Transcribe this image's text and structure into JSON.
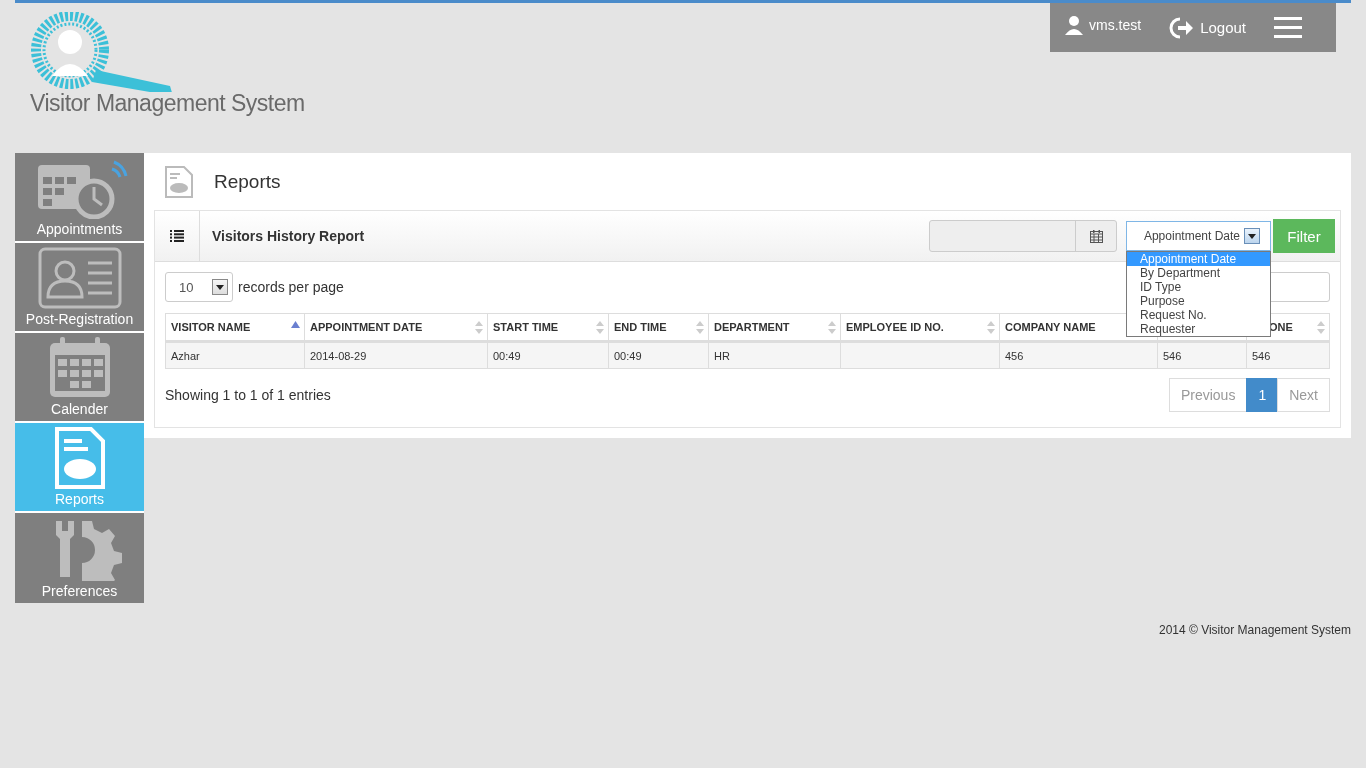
{
  "header": {
    "logo_text": "Visitor Management System",
    "user": "vms.test",
    "logout": "Logout"
  },
  "sidebar": {
    "items": [
      {
        "label": "Appointments",
        "kind": "appointments",
        "selected": false
      },
      {
        "label": "Post-Registration",
        "kind": "registration",
        "selected": false
      },
      {
        "label": "Calender",
        "kind": "calendar",
        "selected": false
      },
      {
        "label": "Reports",
        "kind": "reports",
        "selected": true
      },
      {
        "label": "Preferences",
        "kind": "preferences",
        "selected": false
      }
    ]
  },
  "page": {
    "title": "Reports"
  },
  "report": {
    "title": "Visitors History Report",
    "filter_select": {
      "value": "Appointment Date",
      "expanded": true,
      "options": [
        {
          "label": "Appointment Date",
          "selected": true
        },
        {
          "label": "By Department",
          "selected": false
        },
        {
          "label": "ID Type",
          "selected": false
        },
        {
          "label": "Purpose",
          "selected": false
        },
        {
          "label": "Request No.",
          "selected": false
        },
        {
          "label": "Requester",
          "selected": false
        }
      ]
    },
    "filter_button": "Filter",
    "page_size": "10",
    "page_size_label": "records per page",
    "table": {
      "columns": [
        {
          "label": "VISITOR NAME",
          "sorted": true
        },
        {
          "label": "APPOINTMENT DATE",
          "sorted": false
        },
        {
          "label": "START TIME",
          "sorted": false
        },
        {
          "label": "END TIME",
          "sorted": false
        },
        {
          "label": "DEPARTMENT",
          "sorted": false
        },
        {
          "label": "EMPLOYEE ID NO.",
          "sorted": false
        },
        {
          "label": "COMPANY NAME"
        },
        {},
        {
          "label": "ONE",
          "sorted": false
        }
      ],
      "rows": [
        [
          "Azhar",
          "2014-08-29",
          "00:49",
          "00:49",
          "HR",
          "",
          "456",
          "546",
          "546"
        ]
      ]
    },
    "info": "Showing 1 to 1 of 1 entries",
    "pagination": [
      {
        "label": "Previous",
        "selected": false
      },
      {
        "label": "1",
        "selected": true
      },
      {
        "label": "Next",
        "selected": false
      }
    ]
  },
  "footer": "2014 © Visitor Management System"
}
